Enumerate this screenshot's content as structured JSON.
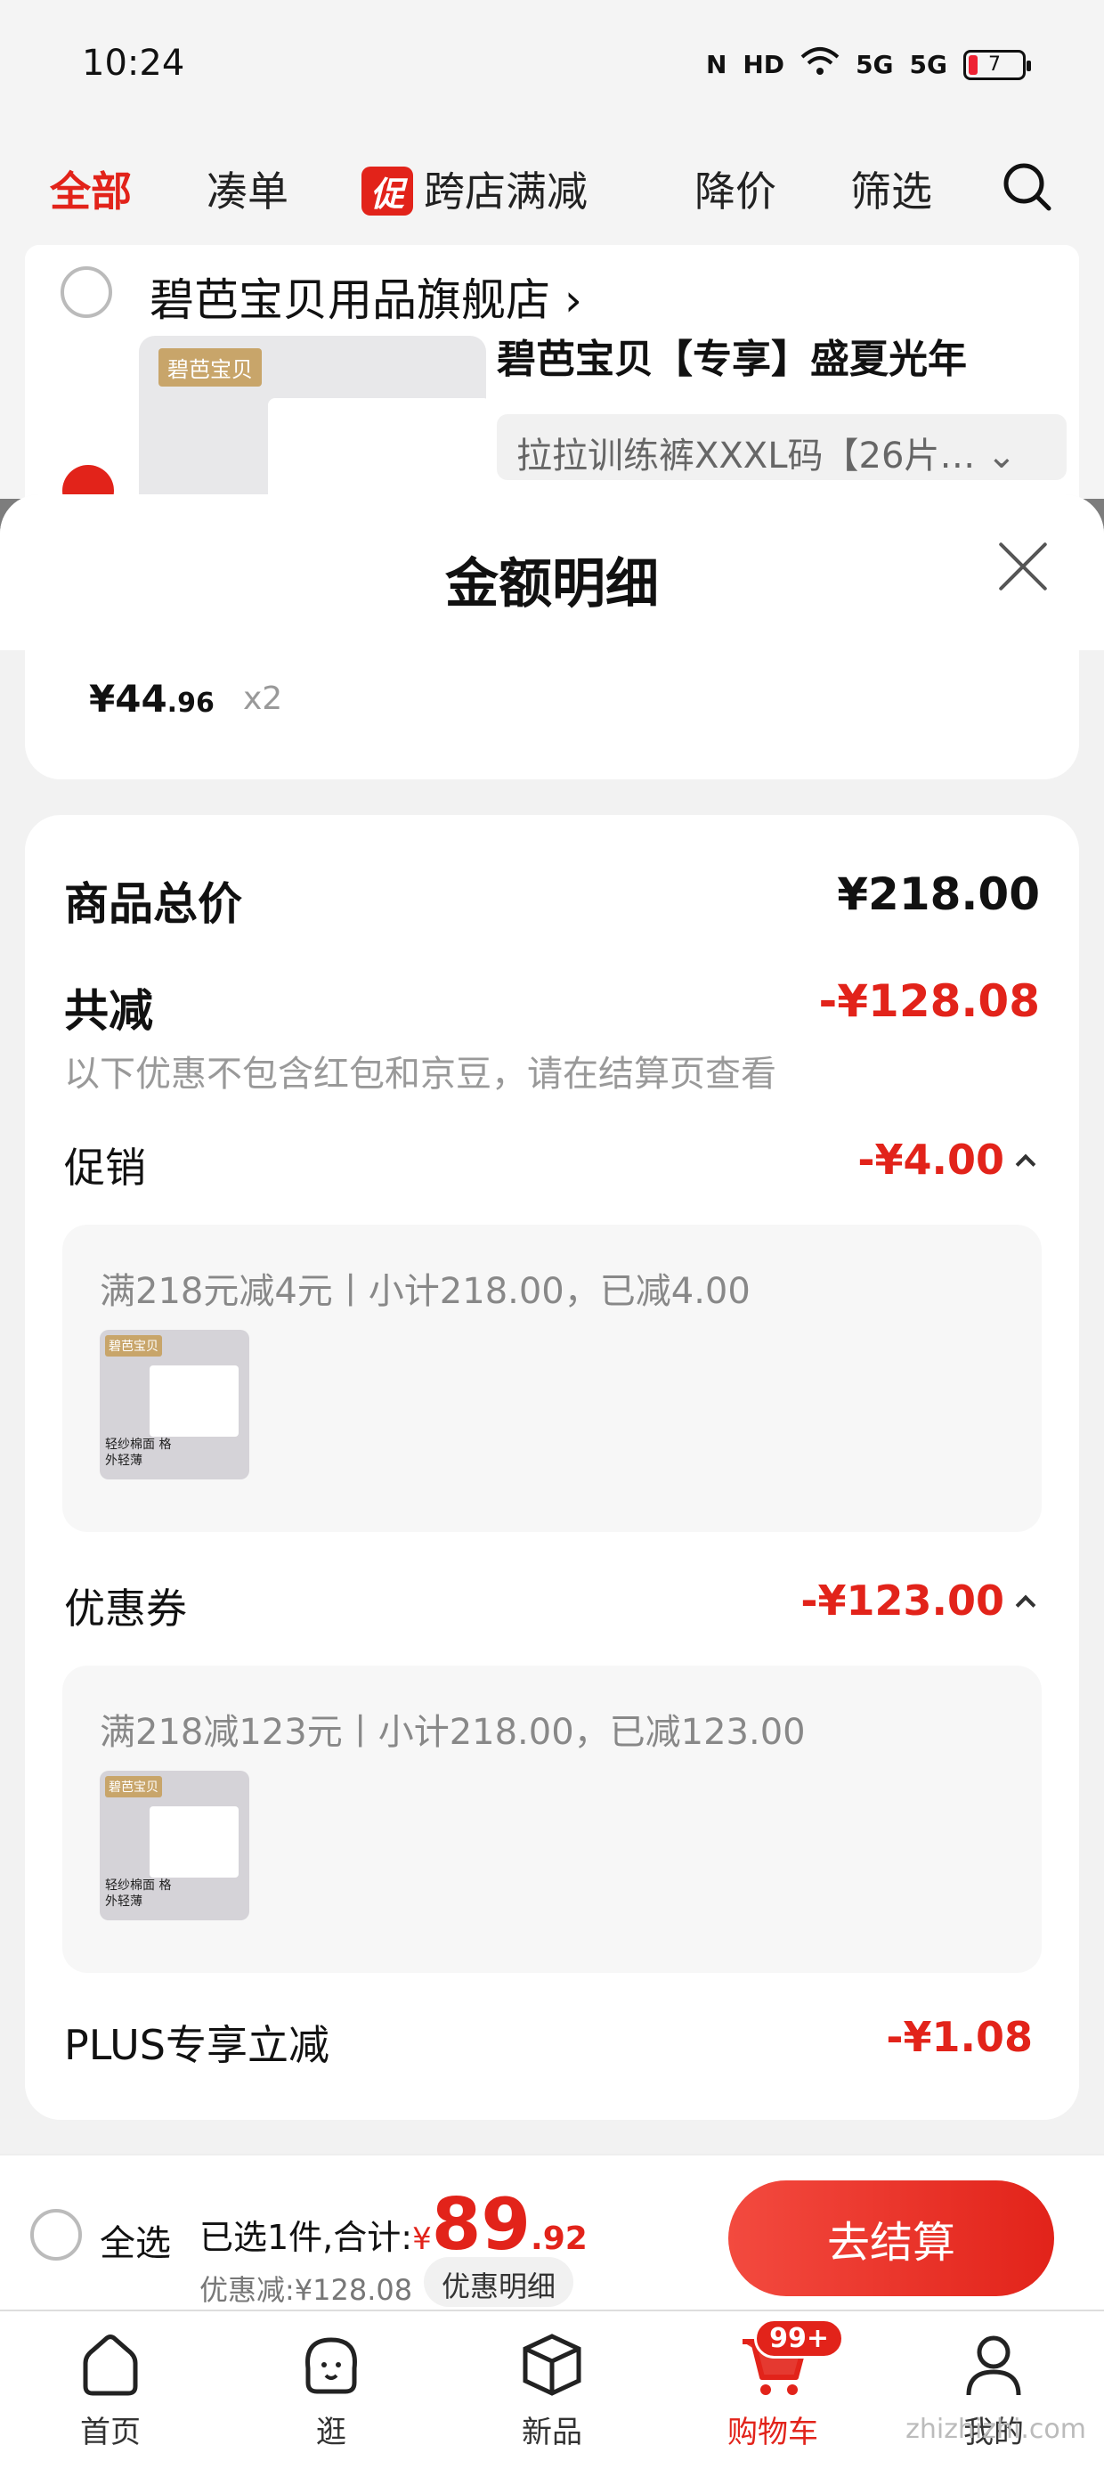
{
  "status_bar": {
    "time": "10:24",
    "icons": [
      "nfc-icon",
      "hd-icon",
      "wifi-icon",
      "5g-signal-icon",
      "5g-signal-icon",
      "battery-icon"
    ],
    "hd_label": "HD",
    "signal1_label": "5G",
    "signal2_label": "5G",
    "battery_level": "7"
  },
  "top_tabs": {
    "all": "全部",
    "bundle": "凑单",
    "promo_badge": "促",
    "cross_store": "跨店满减",
    "price_drop": "降价",
    "filter": "筛选"
  },
  "shop": {
    "name": "碧芭宝贝用品旗舰店",
    "product_logo": "碧芭宝贝",
    "product_title": "碧芭宝贝【专享】盛夏光年",
    "sku": "拉拉训练裤XXXL码【26片…"
  },
  "sheet": {
    "title": "金额明细",
    "item": {
      "price_int": "¥44",
      "price_dec": ".96",
      "qty": "x2"
    },
    "total_label": "商品总价",
    "total_value": "¥218.00",
    "reduce_label": "共减",
    "reduce_value": "-¥128.08",
    "reduce_note": "以下优惠不包含红包和京豆，请在结算页查看",
    "promo": {
      "label": "促销",
      "value": "-¥4.00",
      "detail": "满218元减4元丨小计218.00，已减4.00"
    },
    "coupon": {
      "label": "优惠券",
      "value": "-¥123.00",
      "detail": "满218减123元丨小计218.00，已减123.00"
    },
    "plus": {
      "label": "PLUS专享立减",
      "value": "-¥1.08"
    },
    "thumb_logo": "碧芭宝贝",
    "thumb_text": "轻纱棉面 格外轻薄"
  },
  "checkout": {
    "select_all": "全选",
    "summary_prefix": "已选1件,合计:",
    "currency": "¥",
    "total_int": "89",
    "total_dec": ".92",
    "saving": "优惠减:¥128.08",
    "detail_button": "优惠明细",
    "checkout_button": "去结算"
  },
  "bottom_nav": {
    "home": "首页",
    "browse": "逛",
    "new": "新品",
    "cart": "购物车",
    "cart_badge": "99+",
    "me": "我的"
  },
  "watermark": "zhizhizhi.com",
  "colors": {
    "accent": "#e2231a",
    "overlay": "#7d7d7d"
  }
}
